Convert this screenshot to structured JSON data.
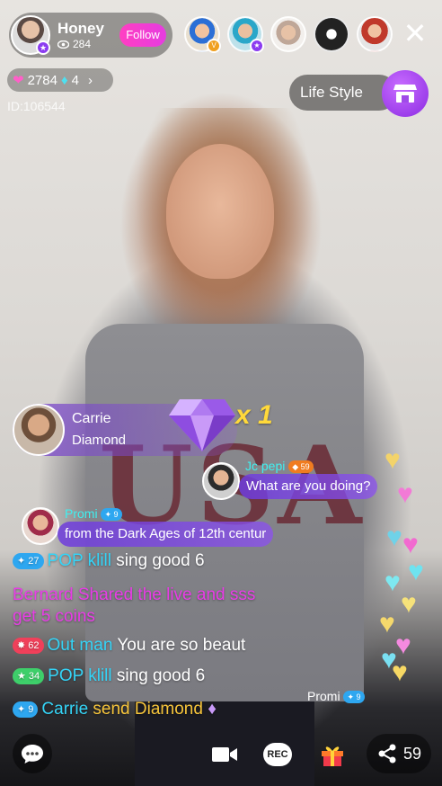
{
  "host": {
    "name": "Honey",
    "views": "284",
    "follow_label": "Follow"
  },
  "stats": {
    "hearts": "2784",
    "diamonds": "4",
    "user_id": "ID:106544"
  },
  "room": {
    "category_label": "Life Style"
  },
  "gift": {
    "sender": "Carrie",
    "item": "Diamond",
    "count": "x 1"
  },
  "chat_bubbles": [
    {
      "name": "Jc pepi",
      "level": "59",
      "text": "What are you doing?"
    },
    {
      "name": "Promi",
      "level": "9",
      "text": "from the Dark Ages of 12th centur"
    }
  ],
  "messages": [
    {
      "level": "27",
      "user": "POP klill",
      "text": "sing good 6"
    },
    {
      "line1": "Bernard Shared the live and sss",
      "line2": "get 5 coins"
    },
    {
      "level": "62",
      "user": "Out man",
      "text": "You are so beaut"
    },
    {
      "level": "34",
      "user": "POP klill",
      "text": "sing good 6"
    },
    {
      "level": "9",
      "user": "Carrie",
      "text": "send Diamond"
    }
  ],
  "floating": {
    "name": "Promi",
    "level": "9"
  },
  "bottom": {
    "rec_label": "REC",
    "share_count": "59"
  },
  "colors": {
    "accent_purple": "#8b2be2",
    "follow_pink": "#ff3fc2",
    "chat_cyan": "#34d4f7",
    "chat_magenta": "#e83ce6"
  }
}
